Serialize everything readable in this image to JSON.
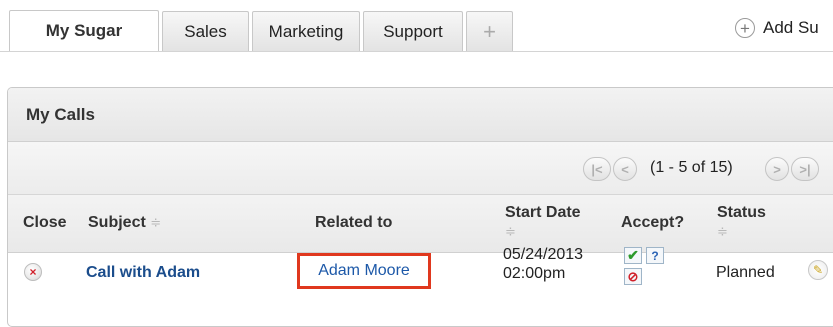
{
  "tabs": [
    {
      "label": "My Sugar",
      "active": true
    },
    {
      "label": "Sales",
      "active": false
    },
    {
      "label": "Marketing",
      "active": false
    },
    {
      "label": "Support",
      "active": false
    },
    {
      "label": "+",
      "active": false
    }
  ],
  "add_sugar": {
    "icon": "plus-circle-icon",
    "label": "Add Su"
  },
  "dashlet": {
    "title": "My Calls",
    "pager": {
      "text": "(1 - 5 of 15)",
      "first_icon": "|<",
      "prev_icon": "<",
      "next_icon": ">",
      "last_icon": ">|"
    },
    "columns": {
      "close": "Close",
      "subject": "Subject",
      "related": "Related to",
      "start_date": "Start Date",
      "accept": "Accept?",
      "status": "Status",
      "sort_glyph": "≑"
    },
    "rows": [
      {
        "close_icon": "×",
        "subject": "Call with Adam",
        "related_to": "Adam Moore",
        "start_date": "05/24/2013",
        "start_time": "02:00pm",
        "accept_yes": "✔",
        "accept_maybe": "?",
        "accept_no": "⊘",
        "status": "Planned",
        "edit_icon": "✎"
      }
    ]
  },
  "colors": {
    "link": "#1c58a8",
    "highlight_border": "#e0381e",
    "close_red": "#d0202a",
    "accept_green": "#2c9a2c"
  }
}
